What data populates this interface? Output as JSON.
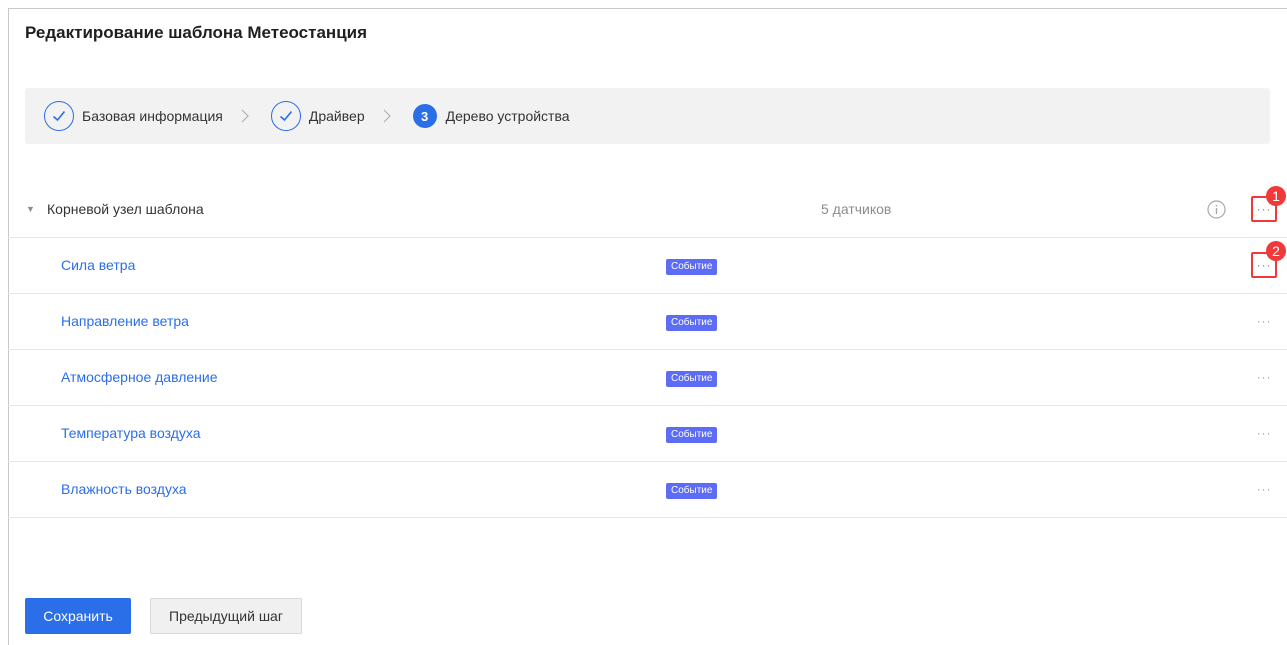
{
  "page": {
    "title": "Редактирование шаблона Метеостанция"
  },
  "steps": [
    {
      "label": "Базовая информация",
      "state": "done"
    },
    {
      "label": "Драйвер",
      "state": "done"
    },
    {
      "label": "Дерево устройства",
      "state": "active",
      "number": "3"
    }
  ],
  "tree": {
    "root": {
      "label": "Корневой узел шаблона",
      "count": "5 датчиков",
      "more": "···"
    },
    "items": [
      {
        "label": "Сила ветра",
        "badge": "Событие",
        "more": "···"
      },
      {
        "label": "Направление ветра",
        "badge": "Событие",
        "more": "···"
      },
      {
        "label": "Атмосферное давление",
        "badge": "Событие",
        "more": "···"
      },
      {
        "label": "Температура воздуха",
        "badge": "Событие",
        "more": "···"
      },
      {
        "label": "Влажность воздуха",
        "badge": "Событие",
        "more": "···"
      }
    ]
  },
  "markers": [
    "1",
    "2"
  ],
  "buttons": {
    "save": "Сохранить",
    "prev": "Предыдущий шаг"
  },
  "colors": {
    "accent": "#2a6ee8",
    "badge": "#5c6cf5",
    "marker": "#f03a3a"
  }
}
